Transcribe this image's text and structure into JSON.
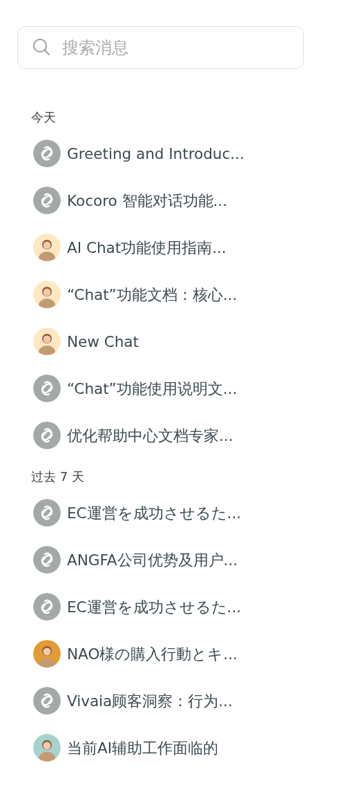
{
  "search": {
    "placeholder": "搜索消息"
  },
  "sections": [
    {
      "title": "今天",
      "items": [
        {
          "title": "Greeting and Introduc...",
          "kind": "logo"
        },
        {
          "title": "Kocoro 智能对话功能...",
          "kind": "logo"
        },
        {
          "title": "AI Chat功能使用指南...",
          "kind": "person",
          "color": "#fde8c2"
        },
        {
          "title": "“Chat”功能文档：核心...",
          "kind": "person",
          "color": "#fde8c2"
        },
        {
          "title": "New Chat",
          "kind": "person",
          "color": "#fde8c2"
        },
        {
          "title": "“Chat”功能使用说明文...",
          "kind": "logo"
        },
        {
          "title": "优化帮助中心文档专家...",
          "kind": "logo"
        }
      ]
    },
    {
      "title": "过去 7 天",
      "items": [
        {
          "title": "EC運営を成功させるた...",
          "kind": "logo"
        },
        {
          "title": "ANGFA公司优势及用户...",
          "kind": "logo"
        },
        {
          "title": "EC運営を成功させるた...",
          "kind": "logo"
        },
        {
          "title": "NAO様の購入行動とキ...",
          "kind": "person",
          "color": "#e39b33"
        },
        {
          "title": "Vivaia顾客洞察：行为...",
          "kind": "logo"
        },
        {
          "title": "当前AI辅助工作面临的",
          "kind": "person",
          "color": "#a7d3cf"
        }
      ]
    }
  ]
}
